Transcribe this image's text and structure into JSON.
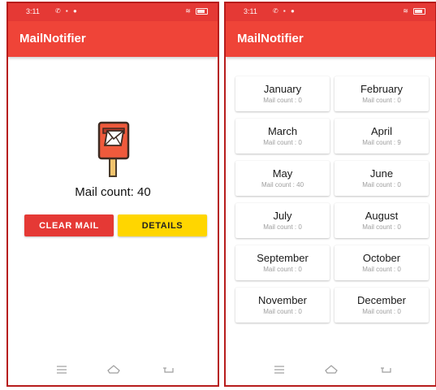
{
  "app_title": "MailNotifier",
  "status": {
    "time": "3:11"
  },
  "home": {
    "mail_count_text": "Mail count: 40",
    "clear_button": "CLEAR MAIL",
    "details_button": "DETAILS"
  },
  "months": [
    {
      "name": "January",
      "count": "Mail count : 0"
    },
    {
      "name": "February",
      "count": "Mail count : 0"
    },
    {
      "name": "March",
      "count": "Mail count : 0"
    },
    {
      "name": "April",
      "count": "Mail count : 9"
    },
    {
      "name": "May",
      "count": "Mail count : 40"
    },
    {
      "name": "June",
      "count": "Mail count : 0"
    },
    {
      "name": "July",
      "count": "Mail count : 0"
    },
    {
      "name": "August",
      "count": "Mail count : 0"
    },
    {
      "name": "September",
      "count": "Mail count : 0"
    },
    {
      "name": "October",
      "count": "Mail count : 0"
    },
    {
      "name": "November",
      "count": "Mail count : 0"
    },
    {
      "name": "December",
      "count": "Mail count : 0"
    }
  ],
  "colors": {
    "app_bar": "#ef4438",
    "status_bar": "#e53935",
    "clear_button": "#e53935",
    "details_button": "#ffd600",
    "frame_border": "#b71c1c"
  },
  "icons": {
    "mailbox": "mailbox-icon",
    "nav": [
      "menu-icon",
      "home-icon",
      "back-icon"
    ]
  }
}
